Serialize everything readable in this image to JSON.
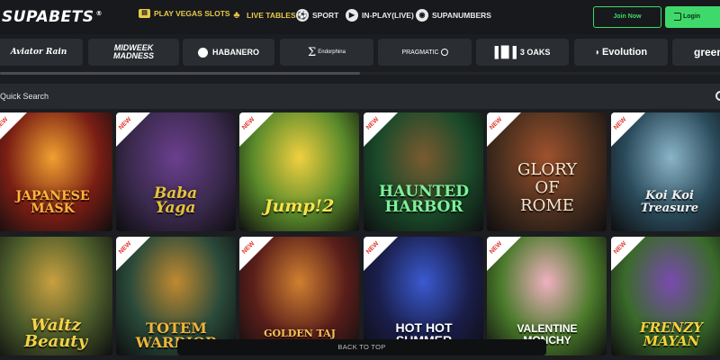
{
  "brand": {
    "name": "SUPABETS",
    "mark": "®"
  },
  "nav": [
    {
      "label": "PLAY VEGAS SLOTS",
      "icon": "slot-machine-icon"
    },
    {
      "label": "LIVE TABLES",
      "icon": "dealer-icon"
    },
    {
      "label": "SPORT",
      "icon": "soccer-ball-icon"
    },
    {
      "label": "IN-PLAY(LIVE)",
      "icon": "live-play-icon"
    },
    {
      "label": "SUPANUMBERS",
      "icon": "lottery-ball-icon"
    }
  ],
  "auth": {
    "join": "Join Now",
    "login": "Login"
  },
  "providers": [
    {
      "label": "Aviator Rain"
    },
    {
      "label": "MIDWEEK MADNESS"
    },
    {
      "label": "HABANERO"
    },
    {
      "label": "Endorphina"
    },
    {
      "label": "PRAGMATIC"
    },
    {
      "label": "3 OAKS"
    },
    {
      "label": "Evolution"
    },
    {
      "label": "green"
    }
  ],
  "search": {
    "placeholder": "Quick Search"
  },
  "games": [
    {
      "title": "JAPANESE MASK",
      "badge": "NEW",
      "bg": "#7a1e14",
      "accent": "#f0a030",
      "text": "#ffb43c"
    },
    {
      "title": "Baba Yaga",
      "badge": "NEW",
      "bg": "#3b2a4e",
      "accent": "#6a3f8e",
      "text": "#e6c23a"
    },
    {
      "title": "Jump!2",
      "badge": "NEW",
      "bg": "#5a8a2a",
      "accent": "#f0d040",
      "text": "#f7e24a"
    },
    {
      "title": "HAUNTED HARBOR",
      "badge": "NEW",
      "bg": "#1a4a2a",
      "accent": "#7a5a30",
      "text": "#7ef09a"
    },
    {
      "title": "GLORY OF ROME",
      "badge": "NEW",
      "bg": "#4a2f1e",
      "accent": "#a0522d",
      "text": "#f2e6d0"
    },
    {
      "title": "Koi Koi Treasure",
      "badge": "NEW",
      "bg": "#2a4a5a",
      "accent": "#8ab4c8",
      "text": "#f0f0f0"
    },
    {
      "title": "Waltz Beauty",
      "badge": "",
      "bg": "#4a5a2a",
      "accent": "#c8a040",
      "text": "#f2d24a"
    },
    {
      "title": "TOTEM WARRIOR",
      "badge": "NEW",
      "bg": "#2a4a3a",
      "accent": "#c08a30",
      "text": "#f0b43c"
    },
    {
      "title": "GOLDEN TAJ MAHAL",
      "badge": "NEW",
      "bg": "#5a1e1a",
      "accent": "#d08030",
      "text": "#f2c45a"
    },
    {
      "title": "HOT HOT SUMMER",
      "badge": "NEW",
      "bg": "#1a1e4a",
      "accent": "#3a5ad0",
      "text": "#ffffff"
    },
    {
      "title": "VALENTINE MONCHY",
      "badge": "NEW",
      "bg": "#4a7a2a",
      "accent": "#f0b0c0",
      "text": "#ffffff"
    },
    {
      "title": "FRENZY MAYAN",
      "badge": "NEW",
      "bg": "#3a6a2a",
      "accent": "#7a4ab0",
      "text": "#f5d23a"
    }
  ],
  "footer": {
    "back_to_top": "BACK TO TOP"
  },
  "colors": {
    "green": "#3fd96b",
    "gold": "#e8c94a",
    "ribbon": "#e0352b"
  }
}
